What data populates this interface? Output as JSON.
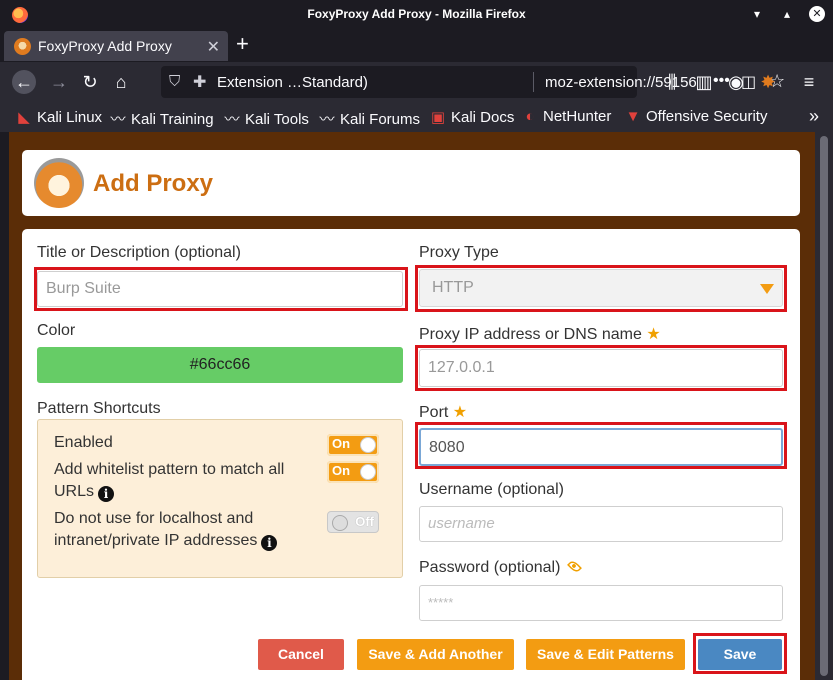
{
  "window": {
    "title": "FoxyProxy Add Proxy - Mozilla Firefox"
  },
  "tab": {
    "label": "FoxyProxy Add Proxy"
  },
  "urlbar": {
    "extension_label": "Extension …Standard)",
    "url": "moz-extension://59156",
    "more": "•••"
  },
  "bookmarks": [
    {
      "label": "Kali Linux",
      "icon": "kali-linux-icon"
    },
    {
      "label": "Kali Training",
      "icon": "kali-dragon-icon"
    },
    {
      "label": "Kali Tools",
      "icon": "kali-dragon-icon"
    },
    {
      "label": "Kali Forums",
      "icon": "kali-dragon-icon"
    },
    {
      "label": "Kali Docs",
      "icon": "kali-docs-icon"
    },
    {
      "label": "NetHunter",
      "icon": "nethunter-icon"
    },
    {
      "label": "Offensive Security",
      "icon": "offsec-icon"
    }
  ],
  "header": {
    "title": "Add Proxy"
  },
  "form": {
    "title_label": "Title or Description (optional)",
    "title_value": "Burp Suite",
    "color_label": "Color",
    "color_value": "#66cc66",
    "shortcuts_label": "Pattern Shortcuts",
    "shortcuts": {
      "enabled": "Enabled",
      "whitelist_line1": "Add whitelist pattern to match all",
      "whitelist_line2": "URLs",
      "localhost_line1": "Do not use for localhost and",
      "localhost_line2": "intranet/private IP addresses",
      "on": "On",
      "off": "Off"
    },
    "proxy_type_label": "Proxy Type",
    "proxy_type_value": "HTTP",
    "ip_label": "Proxy IP address or DNS name",
    "ip_value": "127.0.0.1",
    "port_label": "Port",
    "port_value": "8080",
    "username_label": "Username (optional)",
    "username_placeholder": "username",
    "password_label": "Password (optional)",
    "password_placeholder": "*****"
  },
  "buttons": {
    "cancel": "Cancel",
    "save_add_another": "Save & Add Another",
    "save_edit_patterns": "Save & Edit Patterns",
    "save": "Save"
  },
  "colors": {
    "accent": "#cc6e12",
    "orange": "#f39c12",
    "cancel": "#e05a4a",
    "save": "#4a88c2",
    "highlight": "#d9141a",
    "page_bg": "#5b2d07"
  }
}
